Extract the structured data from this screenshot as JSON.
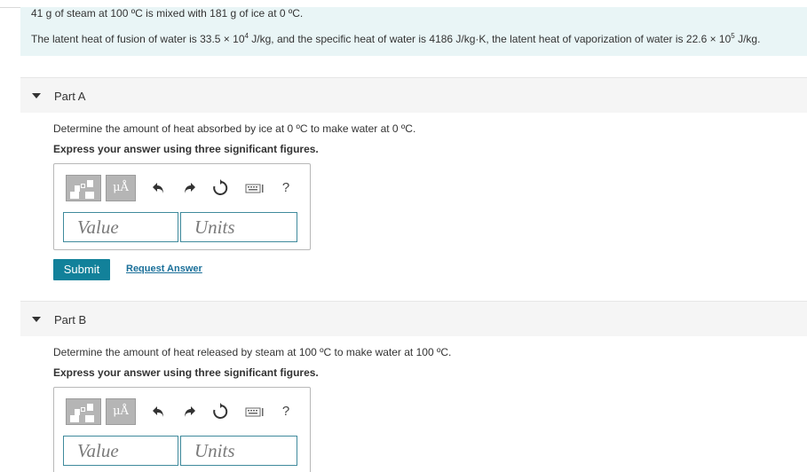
{
  "problem": {
    "line1": "41 g of steam at 100 ºC is mixed with 181 g of ice at 0 ºC.",
    "line2": {
      "before_fusion_exp": "The latent heat of fusion of water is 33.5 × 10",
      "fusion_exp": "4",
      "middle": " J/kg, and the specific heat of water is 4186 J/kg·K, the latent heat of vaporization of water is 22.6 × 10",
      "vapor_exp": "5",
      "end": " J/kg."
    }
  },
  "part_a": {
    "title": "Part A",
    "prompt": "Determine the amount of heat absorbed by ice at 0 ºC to make water at 0 ºC.",
    "instruction": "Express your answer using three significant figures.",
    "units_button": "μÅ",
    "help": "?",
    "value_placeholder": "Value",
    "units_placeholder": "Units",
    "submit_label": "Submit",
    "request_label": "Request Answer"
  },
  "part_b": {
    "title": "Part B",
    "prompt": "Determine the amount of heat released by steam at 100 ºC to make water at 100 ºC.",
    "instruction": "Express your answer using three significant figures.",
    "units_button": "μÅ",
    "help": "?",
    "value_placeholder": "Value",
    "units_placeholder": "Units"
  },
  "icons": {
    "templates": "templates-icon",
    "undo": "undo-icon",
    "redo": "redo-icon",
    "reset": "reset-icon",
    "keyboard": "keyboard-icon"
  },
  "colors": {
    "problem_bg": "#e9f5f6",
    "submit_bg": "#12819a",
    "link": "#1a6f99",
    "field_border": "#3f8a9c"
  }
}
